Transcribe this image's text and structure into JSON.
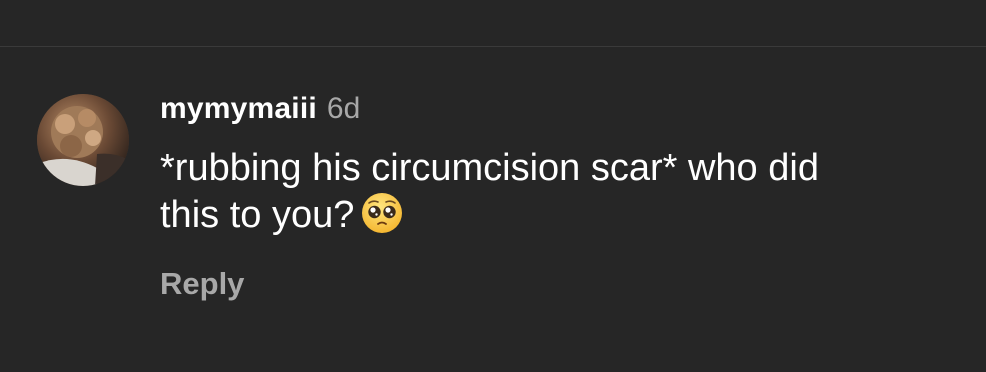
{
  "comment": {
    "username": "mymymaiii",
    "timestamp": "6d",
    "text_line1": "*rubbing his circumcision scar* who did",
    "text_line2": "this to you?",
    "emoji_icon": "pleading-face-icon",
    "reply_label": "Reply"
  },
  "colors": {
    "background": "#262626",
    "text": "#ffffff",
    "muted": "#a8a8a8"
  }
}
